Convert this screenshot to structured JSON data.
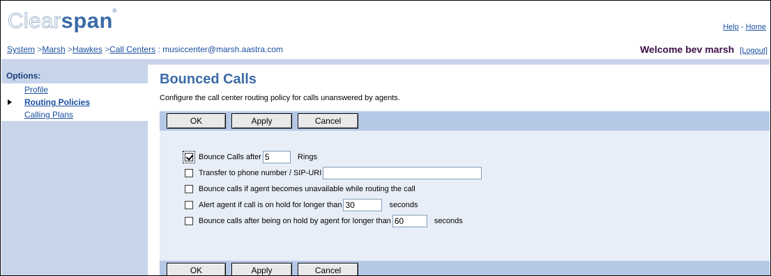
{
  "brand": {
    "logo_light": "Clear",
    "logo_bold": "span",
    "trademark": "®"
  },
  "toplinks": {
    "help": "Help",
    "sep": "-",
    "home": "Home"
  },
  "breadcrumb": {
    "system": "System",
    "gt1": " >",
    "marsh": "Marsh",
    "gt2": " >",
    "hawkes": "Hawkes",
    "gt3": " >",
    "call_centers": "Call Centers",
    "current": " : musiccenter@marsh.aastra.com"
  },
  "welcome": {
    "text": "Welcome bev marsh",
    "logout": "[Logout]"
  },
  "sidebar": {
    "title": "Options:",
    "items": [
      {
        "label": "Profile",
        "active": false
      },
      {
        "label": "Routing Policies",
        "active": true
      },
      {
        "label": "Calling Plans",
        "active": false
      }
    ]
  },
  "main": {
    "title": "Bounced Calls",
    "description": "Configure the call center routing policy for calls unanswered by agents."
  },
  "buttons": {
    "ok": "OK",
    "apply": "Apply",
    "cancel": "Cancel"
  },
  "options": {
    "bounce_after": {
      "label": "Bounce Calls after",
      "checked": true,
      "value": "5",
      "unit": "Rings"
    },
    "transfer": {
      "label": "Transfer to phone number / SIP-URI",
      "checked": false,
      "value": ""
    },
    "unavailable": {
      "label": "Bounce calls if agent becomes unavailable while routing the call",
      "checked": false
    },
    "alert_hold": {
      "label": "Alert agent if call is on hold for longer than",
      "checked": false,
      "value": "30",
      "unit": "seconds"
    },
    "bounce_hold": {
      "label": "Bounce calls after being on hold by agent for longer than",
      "checked": false,
      "value": "60",
      "unit": "seconds"
    }
  }
}
